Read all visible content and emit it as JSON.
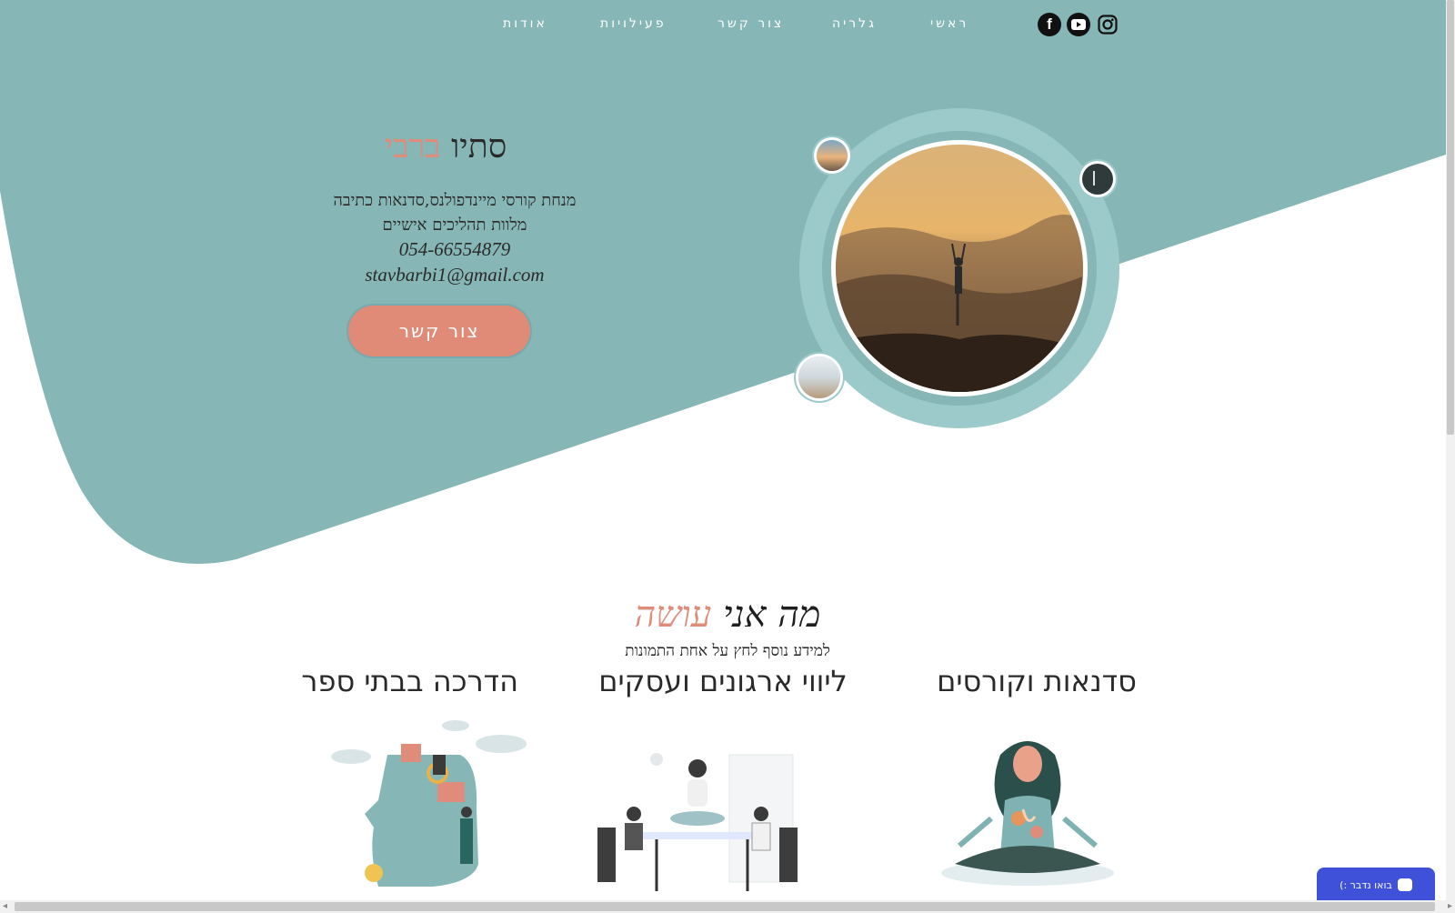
{
  "nav": {
    "items": [
      {
        "id": "about",
        "label": "אודות"
      },
      {
        "id": "activities",
        "label": "פעילויות"
      },
      {
        "id": "contact",
        "label": "צור קשר"
      },
      {
        "id": "gallery",
        "label": "גלריה"
      },
      {
        "id": "home",
        "label": "ראשי"
      }
    ],
    "social": [
      "facebook-icon",
      "youtube-icon",
      "instagram-icon"
    ]
  },
  "hero": {
    "name_first": "סתיו",
    "name_last": "ברבי",
    "subtitle_line1": "מנחת קורסי מיינדפולנס,סדנאות כתיבה",
    "subtitle_line2": "מלוות תהליכים אישיים",
    "phone": "054-66554879",
    "email": "stavbarbi1@gmail.com",
    "cta_label": "צור קשר"
  },
  "services": {
    "title_main": "מה אני",
    "title_accent": "עושה",
    "subtitle": "למידע נוסף לחץ על אחת התמונות",
    "items": [
      {
        "title": "סדנאות וקורסים"
      },
      {
        "title": "ליווי ארגונים ועסקים"
      },
      {
        "title": "הדרכה בבתי ספר"
      }
    ]
  },
  "chat": {
    "label": "בואו נדבר :)"
  },
  "colors": {
    "teal": "#86b6b5",
    "teal_light": "#9ccacb",
    "accent": "#df8c7a",
    "cta": "#e08a78"
  }
}
